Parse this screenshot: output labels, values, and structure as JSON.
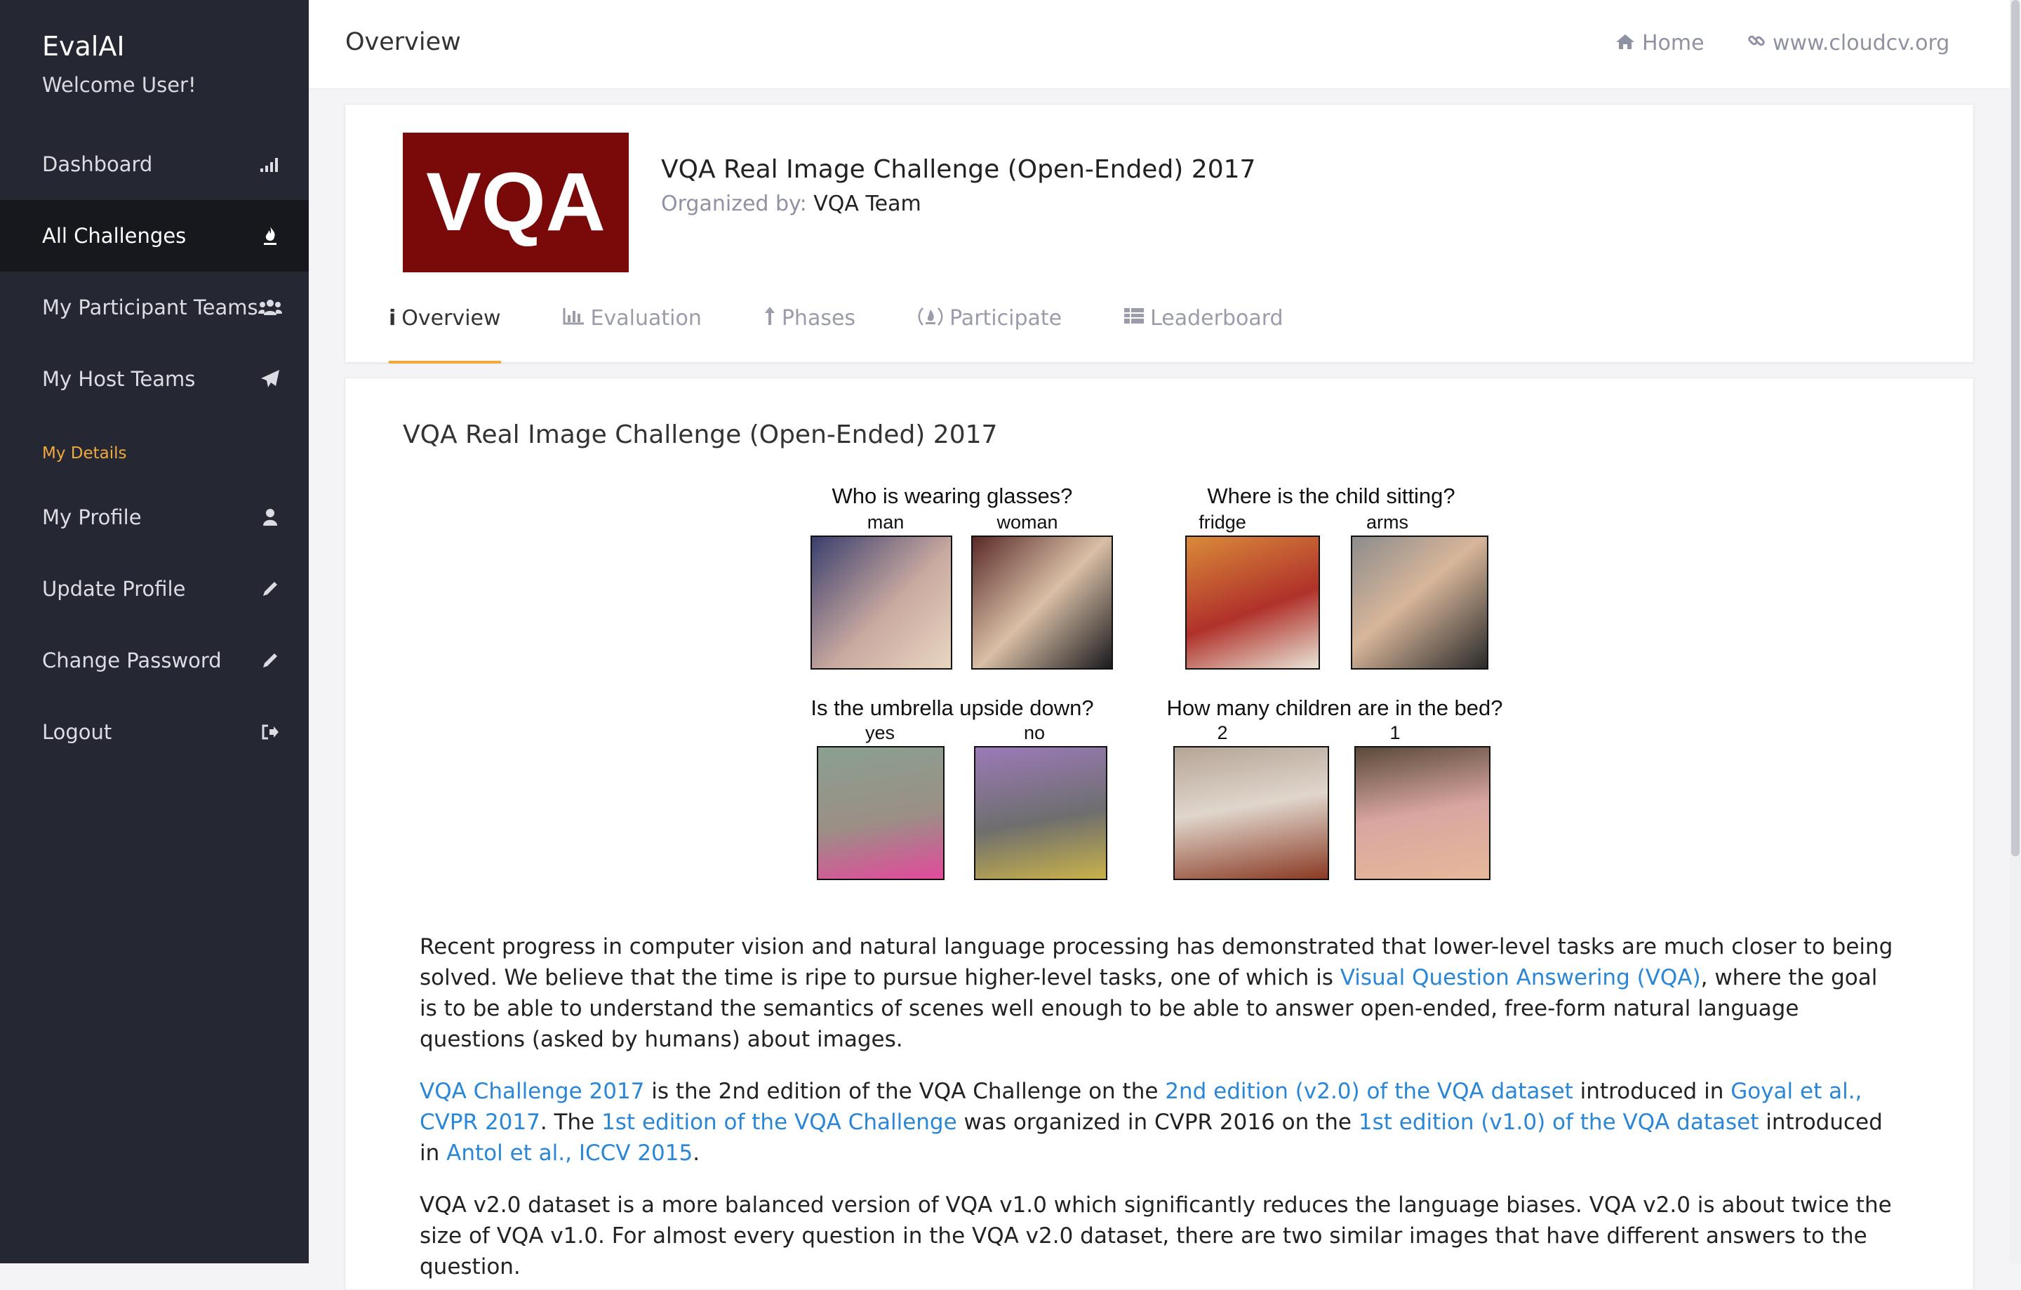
{
  "sidebar": {
    "brand": "EvalAI",
    "welcome": "Welcome User!",
    "items": [
      {
        "label": "Dashboard",
        "icon": "bar-signal-icon"
      },
      {
        "label": "All Challenges",
        "icon": "fire-icon",
        "active": true
      },
      {
        "label": "My Participant Teams",
        "icon": "users-icon"
      },
      {
        "label": "My Host Teams",
        "icon": "paper-plane-icon"
      }
    ],
    "section_label": "My Details",
    "details": [
      {
        "label": "My Profile",
        "icon": "user-icon"
      },
      {
        "label": "Update Profile",
        "icon": "pencil-icon"
      },
      {
        "label": "Change Password",
        "icon": "pencil-icon"
      },
      {
        "label": "Logout",
        "icon": "sign-out-icon"
      }
    ]
  },
  "topbar": {
    "title": "Overview",
    "home_label": "Home",
    "site_label": "www.cloudcv.org"
  },
  "challenge": {
    "logo_text": "VQA",
    "title": "VQA Real Image Challenge (Open-Ended) 2017",
    "organized_by_label": "Organized by:",
    "organizer": "VQA Team",
    "tabs": [
      {
        "label": "Overview",
        "icon": "info-icon",
        "active": true
      },
      {
        "label": "Evaluation",
        "icon": "bar-chart-icon"
      },
      {
        "label": "Phases",
        "icon": "level-up-icon"
      },
      {
        "label": "Participate",
        "icon": "fire-circle-icon"
      },
      {
        "label": "Leaderboard",
        "icon": "table-icon"
      }
    ]
  },
  "content": {
    "title": "VQA Real Image Challenge (Open-Ended) 2017",
    "figure": {
      "q1": "Who is wearing glasses?",
      "q1a": "man",
      "q1b": "woman",
      "q2": "Where is the child sitting?",
      "q2a": "fridge",
      "q2b": "arms",
      "q3": "Is the umbrella upside down?",
      "q3a": "yes",
      "q3b": "no",
      "q4": "How many children are in the bed?",
      "q4a": "2",
      "q4b": "1"
    },
    "p1_a": "Recent progress in computer vision and natural language processing has demonstrated that lower-level tasks are much closer to being solved. We believe that the time is ripe to pursue higher-level tasks, one of which is ",
    "p1_link": "Visual Question Answering (VQA)",
    "p1_b": ", where the goal is to be able to understand the semantics of scenes well enough to be able to answer open-ended, free-form natural language questions (asked by humans) about images.",
    "p2_link1": "VQA Challenge 2017",
    "p2_t1": " is the 2nd edition of the VQA Challenge on the ",
    "p2_link2": "2nd edition (v2.0) of the VQA dataset",
    "p2_t2": " introduced in ",
    "p2_link3": "Goyal et al., CVPR 2017",
    "p2_t3": ". The ",
    "p2_link4": "1st edition of the VQA Challenge",
    "p2_t4": " was organized in CVPR 2016 on the ",
    "p2_link5": "1st edition (v1.0) of the VQA dataset",
    "p2_t5": " introduced in ",
    "p2_link6": "Antol et al., ICCV 2015",
    "p2_t6": ".",
    "p3": "VQA v2.0 dataset is a more balanced version of VQA v1.0 which significantly reduces the language biases. VQA v2.0 is about twice the size of VQA v1.0. For almost every question in the VQA v2.0 dataset, there are two similar images that have different answers to the question."
  },
  "colors": {
    "sidebar": "#252833",
    "accent": "#f0a93e",
    "link": "#2a86d6",
    "logo_bg": "#7a0a0a"
  }
}
